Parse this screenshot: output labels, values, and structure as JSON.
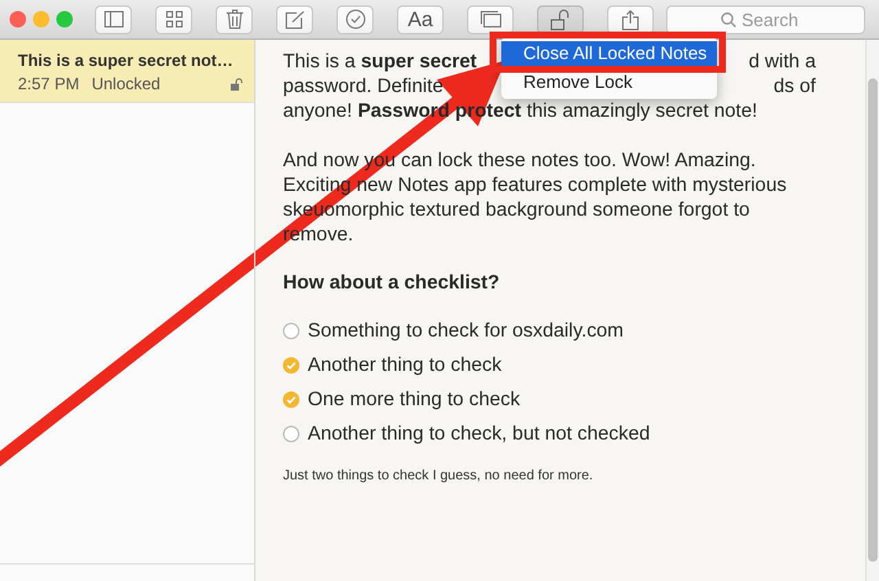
{
  "toolbar": {
    "buttons": [
      {
        "kind": "sidebar",
        "selected": false
      },
      {
        "kind": "grid",
        "selected": false
      },
      {
        "kind": "trash",
        "selected": false
      },
      {
        "kind": "compose",
        "selected": false
      },
      {
        "kind": "checklist",
        "selected": false
      },
      {
        "kind": "text",
        "label": "Aa",
        "selected": false
      },
      {
        "kind": "gallery",
        "selected": false
      },
      {
        "kind": "lock",
        "selected": true
      },
      {
        "kind": "share",
        "selected": false
      }
    ],
    "search": {
      "placeholder": "Search"
    }
  },
  "notes": [
    {
      "title": "This is a super secret not…",
      "time": "2:57 PM",
      "status": "Unlocked",
      "locked": false,
      "selected": true
    }
  ],
  "editor": {
    "intro_lines": [
      {
        "left": "This is a **super secret**",
        "right": "d with a"
      },
      {
        "left": "password. Definite",
        "right": "ds of"
      },
      {
        "left": "anyone! **Password protect** this amazingly secret note!"
      }
    ],
    "paragraph": "And now you can lock these notes too. Wow! Amazing. Exciting new Notes app features complete with mysterious skeuomorphic textured background someone forgot to remove.",
    "heading": "How about a checklist?",
    "checklist": [
      {
        "text": "Something to check for osxdaily.com",
        "checked": false
      },
      {
        "text": "Another thing to check",
        "checked": true
      },
      {
        "text": "One more thing to check",
        "checked": true
      },
      {
        "text": "Another thing to check, but not checked",
        "checked": false
      }
    ],
    "footnote": "Just two things to check I guess, no need for more."
  },
  "menu": {
    "items": [
      {
        "label": "Close All Locked Notes",
        "selected": true
      },
      {
        "label": "Remove Lock",
        "selected": false
      }
    ]
  }
}
